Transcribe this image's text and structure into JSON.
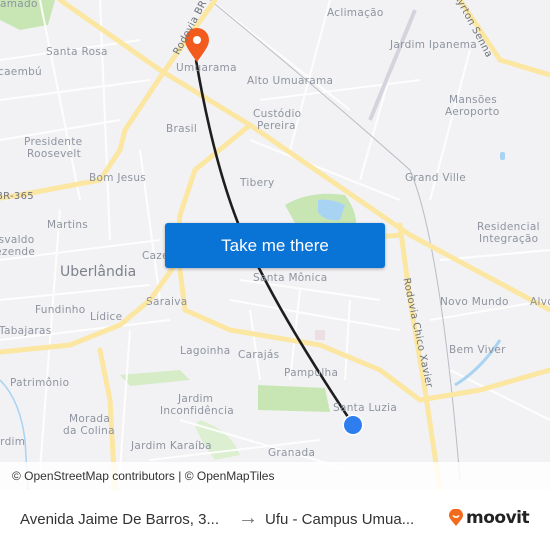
{
  "map": {
    "labels": {
      "residencial_chamado": "Residencial\nChamado",
      "santa_rosa": "Santa Rosa",
      "taiaman_caembu": "Taiaman/Caembú",
      "caembu": "caembú",
      "presidente_roosevelt_1": "Presidente",
      "presidente_roosevelt_2": "Roosevelt",
      "bom_jesus": "Bom Jesus",
      "br365": "BR-365",
      "martins": "Martins",
      "osvaldo_1": "Osvaldo",
      "osvaldo_2": "Rezende",
      "uberlandia": "Uberlândia",
      "cazeca": "Cazeca",
      "fundinho": "Fundinho",
      "lidice": "Lídice",
      "tabajaras": "Tabajaras",
      "saraiva": "Saraiva",
      "lagoinha": "Lagoinha",
      "carajas": "Carajás",
      "patrimonio": "Patrimônio",
      "jardim_inconf_1": "Jardim",
      "jardim_inconf_2": "Inconfidência",
      "morada_1": "Morada",
      "morada_2": "da Colina",
      "jardim_left": "Jardim",
      "jardim_karaiba": "Jardim Karaíba",
      "granada": "Granada",
      "pampulha": "Pampulha",
      "santa_luzia": "Santa Luzia",
      "santa_monica": "Santa Mônica",
      "tibery": "Tibery",
      "brasil": "Brasil",
      "custodio_1": "Custódio",
      "custodio_2": "Pereira",
      "umuarama": "Umuarama",
      "alto_umuarama": "Alto Umuarama",
      "aclimacao": "Aclimação",
      "jardim_ipanema": "Jardim Ipanema",
      "ayrton_senna": "Ayrton Senna",
      "mansoes_1": "Mansões",
      "mansoes_2": "Aeroporto",
      "grand_ville": "Grand Ville",
      "residencial_integ_1": "Residencial",
      "residencial_integ_2": "Integração",
      "novo_mundo": "Novo Mundo",
      "alvorada": "Alvo",
      "bem_viver": "Bem Viver",
      "rodovia_br": "Rodovia BR",
      "rodovia_chico": "Rodovia Chico Xavier"
    },
    "colors": {
      "background": "#f2f2f4",
      "road_major": "#fbe6a2",
      "park": "#c8e6b4",
      "water": "#a9d3f2",
      "route": "#1e1e1e",
      "destination_pin": "#f25a1e",
      "origin_dot": "#2f7ef0"
    }
  },
  "cta": {
    "label": "Take me there",
    "color": "#0a73d6"
  },
  "attribution": "© OpenStreetMap contributors | © OpenMapTiles",
  "footer": {
    "origin": "Avenida Jaime De Barros, 3...",
    "arrow": "→",
    "destination": "Ufu - Campus Umua...",
    "brand": "moovit",
    "brand_color": "#f26a1b"
  }
}
